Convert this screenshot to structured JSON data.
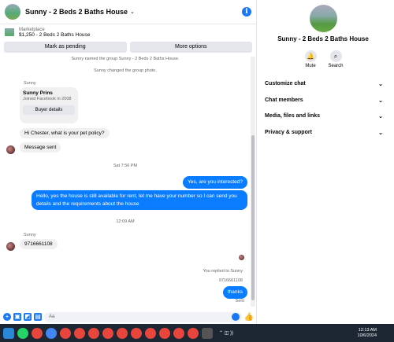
{
  "header": {
    "title": "Sunny - 2 Beds 2 Baths House",
    "info_icon": "i"
  },
  "listing": {
    "source": "Marketplace",
    "name": "$1,250 - 2 Beds 2 Baths House"
  },
  "actions": {
    "mark_pending": "Mark as pending",
    "more_options": "More options"
  },
  "messages": {
    "sys1": "Sunny named the group Sunny - 2 Beds 2 Baths House.",
    "sys2": "Sunny changed the group photo.",
    "sender1": "Sunny",
    "card_name": "Sunny Prins",
    "card_sub": "Joined Facebook in 2008",
    "card_button": "Buyer details",
    "msg1": "Hi Chester, what is your pet policy?",
    "msg2": "Message sent",
    "time1": "Sat 7:56 PM",
    "out1": "Yes, are you interested?",
    "out2": "Hello, yes the house is still available for rent, let me have your number so I can send you details and the requirements about the house",
    "time2": "12:09 AM",
    "sender2": "Sunny",
    "msg3": "9716661108",
    "replied_label": "You replied to Sunny",
    "quoted": "9716661108",
    "out3": "thanks",
    "status": "Sent"
  },
  "composer": {
    "placeholder": "Aa"
  },
  "info_pane": {
    "title": "Sunny - 2 Beds 2 Baths House",
    "mute": "Mute",
    "search": "Search",
    "sections": [
      "Customize chat",
      "Chat members",
      "Media, files and links",
      "Privacy & support"
    ]
  },
  "taskbar": {
    "time": "12:13 AM",
    "date": "10/6/2024"
  },
  "colors": {
    "accent": "#0a7cff",
    "taskbar": "#1c2733"
  }
}
